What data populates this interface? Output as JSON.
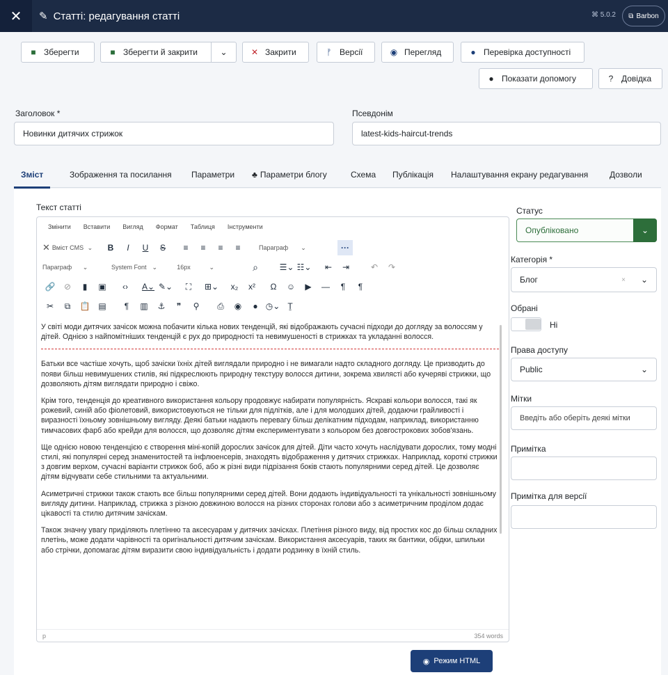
{
  "header": {
    "title": "Статті: редагування статті",
    "version": "5.0.2",
    "site_label": "Barbon"
  },
  "toolbar": {
    "save": "Зберегти",
    "save_close": "Зберегти й закрити",
    "close": "Закрити",
    "versions": "Версії",
    "preview": "Перегляд",
    "accessibility": "Перевірка доступності",
    "show_help": "Показати допомогу",
    "help": "Довідка"
  },
  "form": {
    "title_label": "Заголовок *",
    "title_value": "Новинки дитячих стрижок",
    "alias_label": "Псевдонім",
    "alias_value": "latest-kids-haircut-trends"
  },
  "tabs": [
    "Зміст",
    "Зображення та посилання",
    "Параметри",
    "Параметри блогу",
    "Схема",
    "Публікація",
    "Налаштування екрану редагування",
    "Дозволи"
  ],
  "editor": {
    "label": "Текст статті",
    "menu": [
      "Змінити",
      "Вставити",
      "Вигляд",
      "Формат",
      "Таблиця",
      "Інструменти"
    ],
    "cms_content": "Вміст CMS",
    "paragraph_select": "Параграф",
    "format_select": "Параграф",
    "font_select": "System Font",
    "size_select": "16px",
    "paragraphs": [
      "У світі моди дитячих зачісок можна побачити кілька нових тенденцій, які відображають сучасні підходи до догляду за волоссям у дітей. Однією з найпомітніших тенденцій є рух до природності та невимушеності в стрижках та укладанні волосся.",
      "Батьки все частіше хочуть, щоб зачіски їхніх дітей виглядали природно і не вимагали надто складного догляду. Це призводить до появи більш невимушених стилів, які підкреслюють природну текстуру волосся дитини, зокрема хвилясті або кучеряві стрижки, що дозволяють дітям виглядати природно і свіжо.",
      "Крім того, тенденція до креативного використання кольору продовжує набирати популярність. Яскраві кольори волосся, такі як рожевий, синій або фіолетовий, використовуються не тільки для підлітків, але і для молодших дітей, додаючи грайливості і виразності їхньому зовнішньому вигляду. Деякі батьки надають перевагу більш делікатним підходам, наприклад, використанню тимчасових фарб або крейди для волосся, що дозволяє дітям експериментувати з кольором без довгострокових зобов'язань.",
      "Ще однією новою тенденцією є створення міні-копій дорослих зачісок для дітей. Діти часто хочуть наслідувати дорослих, тому модні стилі, які популярні серед знаменитостей та інфлюенсерів, знаходять відображення у дитячих стрижках. Наприклад, короткі стрижки з довгим верхом, сучасні варіанти стрижок боб, або ж різні види підрізання боків стають популярними серед дітей. Це дозволяє дітям відчувати себе стильними та актуальними.",
      "Асиметричні стрижки також стають все більш популярними серед дітей. Вони додають індивідуальності та унікальності зовнішньому вигляду дитини. Наприклад, стрижка з різною довжиною волосся на різних сторонах голови або з асиметричним проділом додає цікавості та стилю дитячим зачіскам.",
      "Також значну увагу приділяють плетінню та аксесуарам у дитячих зачісках. Плетіння різного виду, від простих кос до більш складних плетінь, може додати чарівності та оригінальності дитячим зачіскам. Використання аксесуарів, таких як бантики, обідки, шпильки або стрічки, допомагає дітям виразити свою індивідуальність і додати родзинку в їхній стиль."
    ],
    "path": "p",
    "word_count": "354 words",
    "html_mode": "Режим HTML"
  },
  "sidebar": {
    "status_label": "Статус",
    "status_value": "Опубліковано",
    "category_label": "Категорія *",
    "category_value": "Блог",
    "featured_label": "Обрані",
    "featured_value": "Ні",
    "access_label": "Права доступу",
    "access_value": "Public",
    "tags_label": "Мітки",
    "tags_placeholder": "Введіть або оберіть деякі мітки",
    "note_label": "Примітка",
    "version_note_label": "Примітка для версії"
  },
  "colors": {
    "header": "#1c2b45",
    "primary": "#1d3f78",
    "success": "#2d6e3a",
    "danger": "#c0262d"
  }
}
